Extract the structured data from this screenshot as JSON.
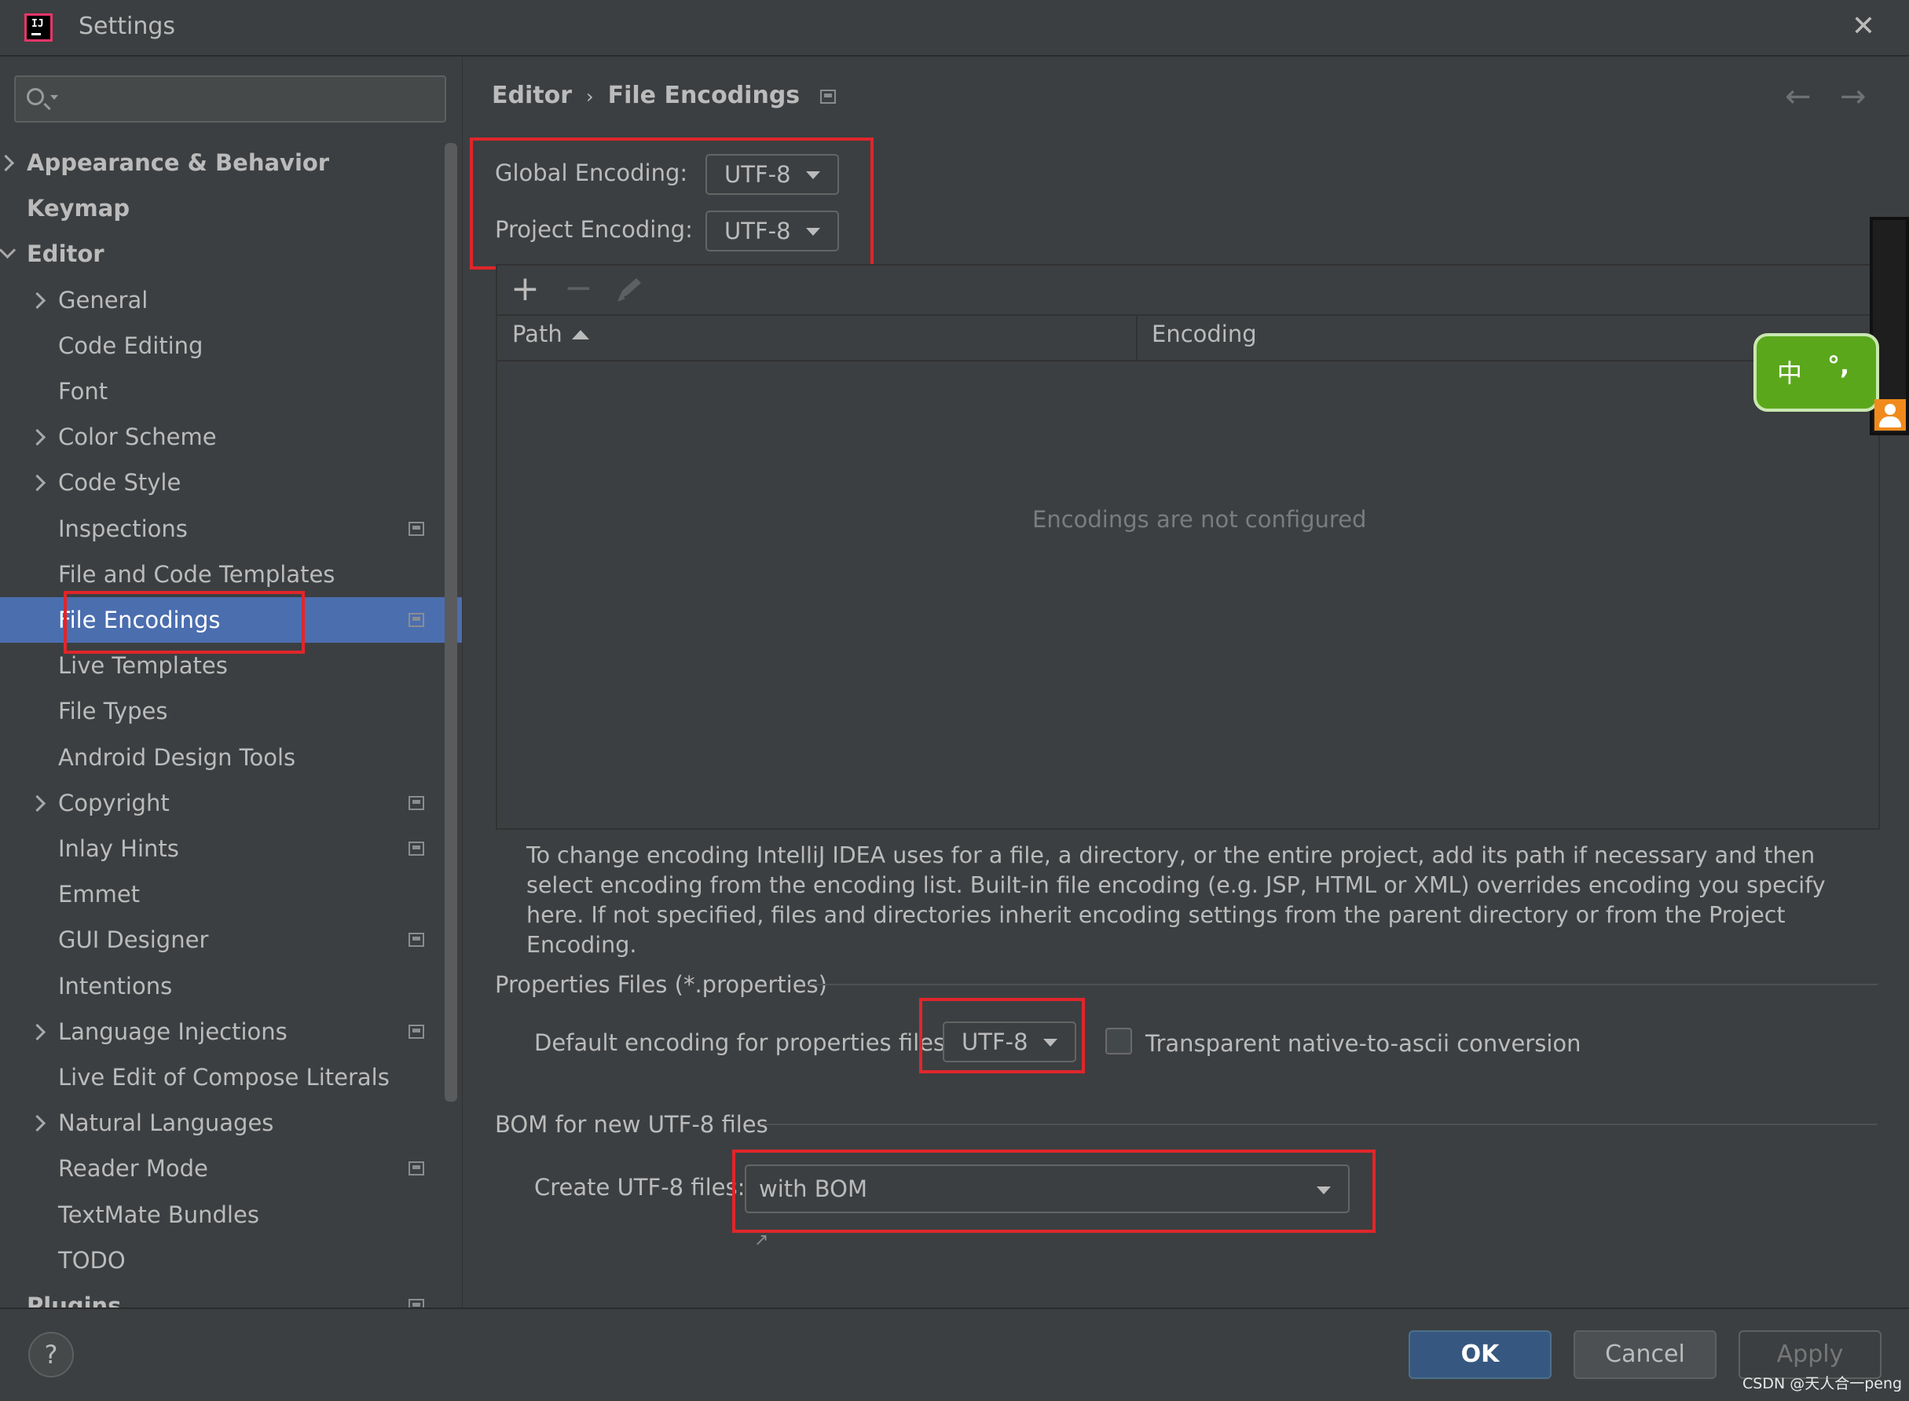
{
  "window": {
    "title": "Settings",
    "app_icon": "intellij-idea-icon",
    "close_icon": "close-icon",
    "close_glyph": "✕"
  },
  "search": {
    "placeholder": "",
    "value": "",
    "icon": "search-icon"
  },
  "sidebar": {
    "items": [
      {
        "label": "Appearance & Behavior",
        "bold": true,
        "level": 0,
        "chevron": "right",
        "project_icon": false
      },
      {
        "label": "Keymap",
        "bold": true,
        "level": 0,
        "chevron": "none",
        "project_icon": false
      },
      {
        "label": "Editor",
        "bold": true,
        "level": 0,
        "chevron": "down",
        "project_icon": false
      },
      {
        "label": "General",
        "bold": false,
        "level": 1,
        "chevron": "right",
        "project_icon": false
      },
      {
        "label": "Code Editing",
        "bold": false,
        "level": 1,
        "chevron": "none",
        "project_icon": false
      },
      {
        "label": "Font",
        "bold": false,
        "level": 1,
        "chevron": "none",
        "project_icon": false
      },
      {
        "label": "Color Scheme",
        "bold": false,
        "level": 1,
        "chevron": "right",
        "project_icon": false
      },
      {
        "label": "Code Style",
        "bold": false,
        "level": 1,
        "chevron": "right",
        "project_icon": false
      },
      {
        "label": "Inspections",
        "bold": false,
        "level": 1,
        "chevron": "none",
        "project_icon": true
      },
      {
        "label": "File and Code Templates",
        "bold": false,
        "level": 1,
        "chevron": "none",
        "project_icon": false
      },
      {
        "label": "File Encodings",
        "bold": false,
        "level": 1,
        "chevron": "none",
        "project_icon": true,
        "selected": true
      },
      {
        "label": "Live Templates",
        "bold": false,
        "level": 1,
        "chevron": "none",
        "project_icon": false
      },
      {
        "label": "File Types",
        "bold": false,
        "level": 1,
        "chevron": "none",
        "project_icon": false
      },
      {
        "label": "Android Design Tools",
        "bold": false,
        "level": 1,
        "chevron": "none",
        "project_icon": false
      },
      {
        "label": "Copyright",
        "bold": false,
        "level": 1,
        "chevron": "right",
        "project_icon": true
      },
      {
        "label": "Inlay Hints",
        "bold": false,
        "level": 1,
        "chevron": "none",
        "project_icon": true
      },
      {
        "label": "Emmet",
        "bold": false,
        "level": 1,
        "chevron": "none",
        "project_icon": false
      },
      {
        "label": "GUI Designer",
        "bold": false,
        "level": 1,
        "chevron": "none",
        "project_icon": true
      },
      {
        "label": "Intentions",
        "bold": false,
        "level": 1,
        "chevron": "none",
        "project_icon": false
      },
      {
        "label": "Language Injections",
        "bold": false,
        "level": 1,
        "chevron": "right",
        "project_icon": true
      },
      {
        "label": "Live Edit of Compose Literals",
        "bold": false,
        "level": 1,
        "chevron": "none",
        "project_icon": false
      },
      {
        "label": "Natural Languages",
        "bold": false,
        "level": 1,
        "chevron": "right",
        "project_icon": false
      },
      {
        "label": "Reader Mode",
        "bold": false,
        "level": 1,
        "chevron": "none",
        "project_icon": true
      },
      {
        "label": "TextMate Bundles",
        "bold": false,
        "level": 1,
        "chevron": "none",
        "project_icon": false
      },
      {
        "label": "TODO",
        "bold": false,
        "level": 1,
        "chevron": "none",
        "project_icon": false
      },
      {
        "label": "Plugins",
        "bold": true,
        "level": 0,
        "chevron": "none",
        "project_icon": true
      }
    ]
  },
  "breadcrumb": {
    "parent": "Editor",
    "separator": "›",
    "current": "File Encodings"
  },
  "nav": {
    "back_glyph": "←",
    "forward_glyph": "→"
  },
  "encodings": {
    "global_label": "Global Encoding:",
    "global_value": "UTF-8",
    "project_label": "Project Encoding:",
    "project_value": "UTF-8"
  },
  "table": {
    "add_glyph": "+",
    "remove_glyph": "−",
    "columns": [
      "Path",
      "Encoding"
    ],
    "sort_column": "Path",
    "sort_direction": "ascending",
    "empty_text": "Encodings are not configured",
    "rows": []
  },
  "help_text": "To change encoding IntelliJ IDEA uses for a file, a directory, or the entire project, add its path if necessary and then select encoding from the encoding list. Built-in file encoding (e.g. JSP, HTML or XML) overrides encoding you specify here. If not specified, files and directories inherit encoding settings from the parent directory or from the Project Encoding.",
  "properties": {
    "section_title": "Properties Files (*.properties)",
    "default_label": "Default encoding for properties files:",
    "default_value": "UTF-8",
    "transparent_label": "Transparent native-to-ascii conversion",
    "transparent_checked": false
  },
  "bom": {
    "section_title": "BOM for new UTF-8 files",
    "create_label": "Create UTF-8 files:",
    "create_value": "with BOM"
  },
  "ime_widget": {
    "char": "中",
    "punct": "°,"
  },
  "footer": {
    "help_label": "?",
    "ok_label": "OK",
    "cancel_label": "Cancel",
    "apply_label": "Apply",
    "watermark": "CSDN @天人合一peng"
  },
  "colors": {
    "background": "#3c3f41",
    "selection": "#4b6eaf",
    "primary_button": "#365880",
    "annotation_red": "#e0262b",
    "ime_green": "#5ba71c"
  }
}
